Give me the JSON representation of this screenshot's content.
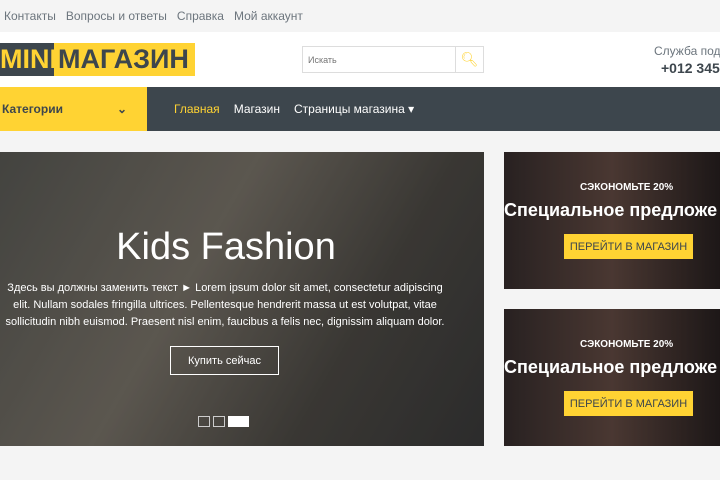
{
  "topbar": {
    "links": [
      "Контакты",
      "Вопросы и ответы",
      "Справка",
      "Мой аккаунт"
    ]
  },
  "logo": {
    "part1": "MINI",
    "part2": "МАГАЗИН"
  },
  "search": {
    "placeholder": "Искать"
  },
  "support": {
    "label": "Служба подд",
    "phone": "+012 345"
  },
  "nav": {
    "categories": "Категории",
    "links": [
      "Главная",
      "Магазин",
      "Страницы магазина"
    ]
  },
  "hero": {
    "title": "Kids Fashion",
    "text": "Здесь вы должны заменить текст ► Lorem ipsum dolor sit amet, consectetur adipiscing elit. Nullam sodales fringilla ultrices. Pellentesque hendrerit massa ut est volutpat, vitae sollicitudin nibh euismod. Praesent nisl enim, faucibus a felis nec, dignissim aliquam dolor.",
    "button": "Купить сейчас",
    "active_slide": 3,
    "slides": 3
  },
  "promos": [
    {
      "save": "СЭКОНОМЬТЕ 20%",
      "title": "Специальное предложе",
      "button": "ПЕРЕЙТИ В МАГАЗИН"
    },
    {
      "save": "СЭКОНОМЬТЕ 20%",
      "title": "Специальное предложе",
      "button": "ПЕРЕЙТИ В МАГАЗИН"
    }
  ]
}
